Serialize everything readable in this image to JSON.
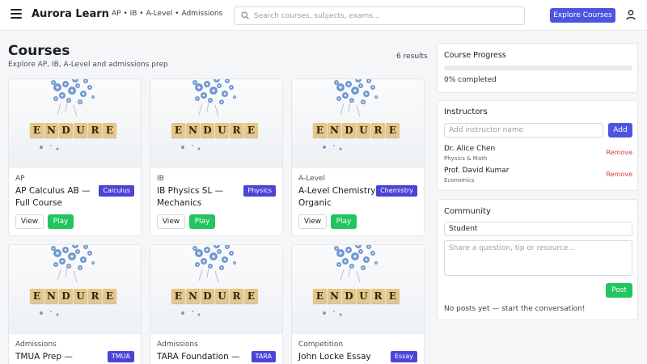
{
  "header": {
    "brand": "Aurora Learn",
    "breadcrumb": "AP • IB • A-Level • Admissions",
    "search_placeholder": "Search courses, subjects, exams...",
    "explore_label": "Explore Courses"
  },
  "main": {
    "title": "Courses",
    "subtitle": "Explore AP, IB, A-Level and admissions prep",
    "results": "6 results",
    "thumb_word": [
      "E",
      "N",
      "D",
      "U",
      "R",
      "E"
    ],
    "courses": [
      {
        "category": "AP",
        "title": "AP Calculus AB — Full Course",
        "badge": "Calculus",
        "view": "View",
        "play": "Play"
      },
      {
        "category": "IB",
        "title": "IB Physics SL — Mechanics",
        "badge": "Physics",
        "view": "View",
        "play": "Play"
      },
      {
        "category": "A-Level",
        "title": "A-Level Chemistry — Organic",
        "badge": "Chemistry",
        "view": "View",
        "play": "Play"
      },
      {
        "category": "Admissions",
        "title": "TMUA Prep — Problem",
        "badge": "TMUA"
      },
      {
        "category": "Admissions",
        "title": "TARA Foundation —",
        "badge": "TARA"
      },
      {
        "category": "Competition",
        "title": "John Locke Essay",
        "badge": "Essay"
      }
    ]
  },
  "sidebar": {
    "progress": {
      "heading": "Course Progress",
      "text": "0% completed",
      "value_percent": 0
    },
    "instructors": {
      "heading": "Instructors",
      "input_placeholder": "Add instructor name",
      "add_label": "Add",
      "items": [
        {
          "name": "Dr. Alice Chen",
          "subject": "Physics & Math",
          "remove": "Remove"
        },
        {
          "name": "Prof. David Kumar",
          "subject": "Economics",
          "remove": "Remove"
        }
      ]
    },
    "community": {
      "heading": "Community",
      "name_value": "Student",
      "post_placeholder": "Share a question, tip or resource...",
      "post_label": "Post",
      "empty_text": "No posts yet — start the conversation!"
    }
  },
  "colors": {
    "accent": "#4b55e0",
    "play": "#22c55e",
    "badge": "#4b44d6",
    "remove": "#d33b3b"
  }
}
